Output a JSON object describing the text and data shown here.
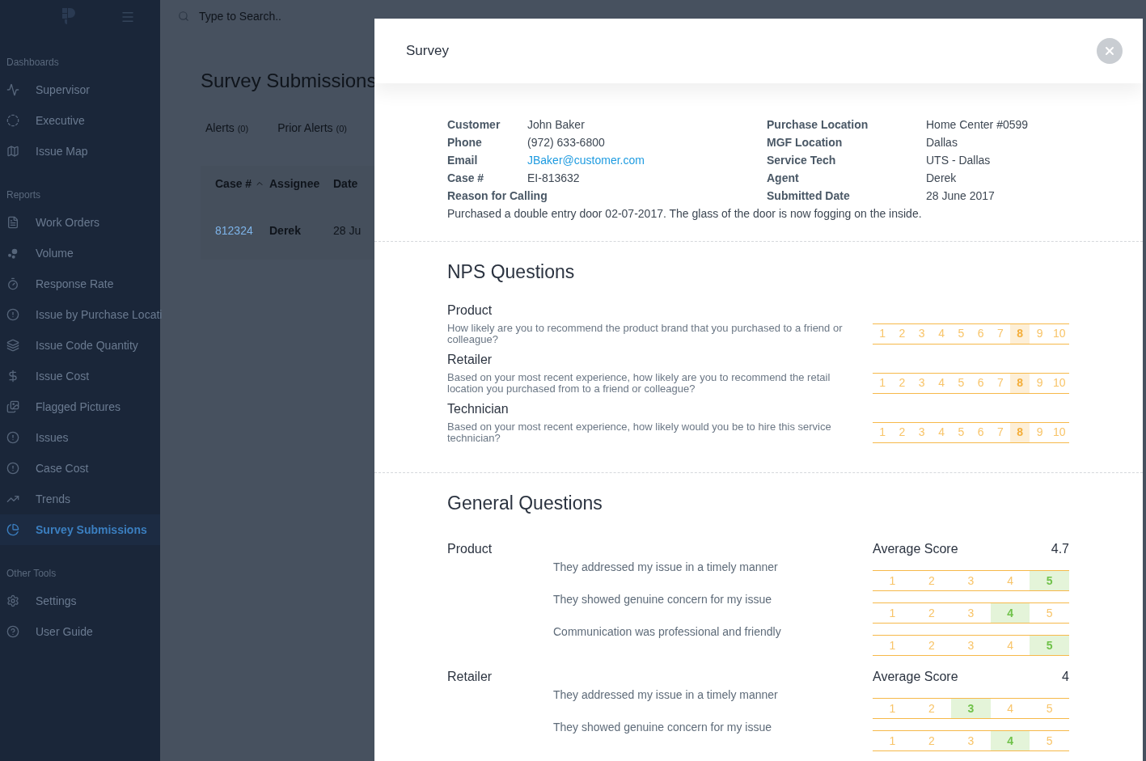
{
  "sidebar": {
    "sections": [
      {
        "heading": "Dashboards",
        "items": [
          {
            "label": "Supervisor",
            "selected": false
          },
          {
            "label": "Executive",
            "selected": false
          },
          {
            "label": "Issue Map",
            "selected": false
          }
        ]
      },
      {
        "heading": "Reports",
        "items": [
          {
            "label": "Work Orders",
            "selected": false
          },
          {
            "label": "Volume",
            "selected": false
          },
          {
            "label": "Response Rate",
            "selected": false
          },
          {
            "label": "Issue by Purchase Locati",
            "selected": false
          },
          {
            "label": "Issue Code Quantity",
            "selected": false
          },
          {
            "label": "Issue Cost",
            "selected": false
          },
          {
            "label": "Flagged Pictures",
            "selected": false
          },
          {
            "label": "Issues",
            "selected": false
          },
          {
            "label": "Case Cost",
            "selected": false
          },
          {
            "label": "Trends",
            "selected": false
          },
          {
            "label": "Survey Submissions",
            "selected": true
          }
        ]
      },
      {
        "heading": "Other Tools",
        "items": [
          {
            "label": "Settings",
            "selected": false
          },
          {
            "label": "User Guide",
            "selected": false
          }
        ]
      }
    ]
  },
  "search": {
    "placeholder": "Type to Search.."
  },
  "page_title": "Survey Submissions",
  "tabs": [
    {
      "label": "Alerts",
      "count": "(0)",
      "selected": false
    },
    {
      "label": "Prior Alerts",
      "count": "(0)",
      "selected": false
    }
  ],
  "table": {
    "columns": [
      "Case #",
      "Assignee",
      "Date"
    ],
    "rows": [
      [
        "812324",
        "Derek",
        "28 Ju"
      ]
    ]
  },
  "modal": {
    "title": "Survey",
    "info_left": [
      {
        "label": "Customer",
        "value": "John Baker",
        "kind": "text"
      },
      {
        "label": "Phone",
        "value": "(972) 633-6800",
        "kind": "text"
      },
      {
        "label": "Email",
        "value": "JBaker@customer.com",
        "kind": "link"
      },
      {
        "label": "Case #",
        "value": "EI-813632",
        "kind": "text"
      },
      {
        "label": "Reason for Calling"
      }
    ],
    "info_right": [
      {
        "label": "Purchase Location",
        "value": "Home Center #0599"
      },
      {
        "label": "MGF Location",
        "value": "Dallas"
      },
      {
        "label": "Service Tech",
        "value": "UTS - Dallas"
      },
      {
        "label": "Agent",
        "value": "Derek"
      },
      {
        "label": "Submitted Date",
        "value": "28 June 2017"
      }
    ],
    "reason": "Purchased a double entry door 02-07-2017. The glass of the door is now fogging on the inside.",
    "nps": {
      "heading": "NPS Questions",
      "questions": [
        {
          "title": "Product",
          "text": "How likely are you to recommend the product brand that you purchased to a friend or colleague?",
          "scale": [
            {
              "label": "1",
              "selected": false
            },
            {
              "label": "2",
              "selected": false
            },
            {
              "label": "3",
              "selected": false
            },
            {
              "label": "4",
              "selected": false
            },
            {
              "label": "5",
              "selected": false
            },
            {
              "label": "6",
              "selected": false
            },
            {
              "label": "7",
              "selected": false
            },
            {
              "label": "8",
              "selected": true
            },
            {
              "label": "9",
              "selected": false
            },
            {
              "label": "10",
              "selected": false
            }
          ]
        },
        {
          "title": "Retailer",
          "text": "Based on your most recent experience, how likely are you to recommend the retail location you purchased from to a friend or colleague?",
          "scale": [
            {
              "label": "1",
              "selected": false
            },
            {
              "label": "2",
              "selected": false
            },
            {
              "label": "3",
              "selected": false
            },
            {
              "label": "4",
              "selected": false
            },
            {
              "label": "5",
              "selected": false
            },
            {
              "label": "6",
              "selected": false
            },
            {
              "label": "7",
              "selected": false
            },
            {
              "label": "8",
              "selected": true
            },
            {
              "label": "9",
              "selected": false
            },
            {
              "label": "10",
              "selected": false
            }
          ]
        },
        {
          "title": "Technician",
          "text": "Based on your most recent experience, how likely would you be to hire this service technician?",
          "scale": [
            {
              "label": "1",
              "selected": false
            },
            {
              "label": "2",
              "selected": false
            },
            {
              "label": "3",
              "selected": false
            },
            {
              "label": "4",
              "selected": false
            },
            {
              "label": "5",
              "selected": false
            },
            {
              "label": "6",
              "selected": false
            },
            {
              "label": "7",
              "selected": false
            },
            {
              "label": "8",
              "selected": true
            },
            {
              "label": "9",
              "selected": false
            },
            {
              "label": "10",
              "selected": false
            }
          ]
        }
      ]
    },
    "general": {
      "heading": "General Questions",
      "groups": [
        {
          "title": "Product",
          "average_label": "Average Score",
          "average": "4.7",
          "questions": [
            {
              "text": "They addressed my issue in a timely manner",
              "scale": [
                {
                  "label": "1",
                  "selected": false
                },
                {
                  "label": "2",
                  "selected": false
                },
                {
                  "label": "3",
                  "selected": false
                },
                {
                  "label": "4",
                  "selected": false
                },
                {
                  "label": "5",
                  "selected": true
                }
              ]
            },
            {
              "text": "They showed genuine concern for my issue",
              "scale": [
                {
                  "label": "1",
                  "selected": false
                },
                {
                  "label": "2",
                  "selected": false
                },
                {
                  "label": "3",
                  "selected": false
                },
                {
                  "label": "4",
                  "selected": true
                },
                {
                  "label": "5",
                  "selected": false
                }
              ]
            },
            {
              "text": "Communication was professional and friendly",
              "scale": [
                {
                  "label": "1",
                  "selected": false
                },
                {
                  "label": "2",
                  "selected": false
                },
                {
                  "label": "3",
                  "selected": false
                },
                {
                  "label": "4",
                  "selected": false
                },
                {
                  "label": "5",
                  "selected": true
                }
              ]
            }
          ]
        },
        {
          "title": "Retailer",
          "average_label": "Average Score",
          "average": "4",
          "questions": [
            {
              "text": "They addressed my issue in a timely manner",
              "scale": [
                {
                  "label": "1",
                  "selected": false
                },
                {
                  "label": "2",
                  "selected": false
                },
                {
                  "label": "3",
                  "selected": true
                },
                {
                  "label": "4",
                  "selected": false
                },
                {
                  "label": "5",
                  "selected": false
                }
              ]
            },
            {
              "text": "They showed genuine concern for my issue",
              "scale": [
                {
                  "label": "1",
                  "selected": false
                },
                {
                  "label": "2",
                  "selected": false
                },
                {
                  "label": "3",
                  "selected": false
                },
                {
                  "label": "4",
                  "selected": true
                },
                {
                  "label": "5",
                  "selected": false
                }
              ]
            }
          ]
        }
      ]
    }
  }
}
